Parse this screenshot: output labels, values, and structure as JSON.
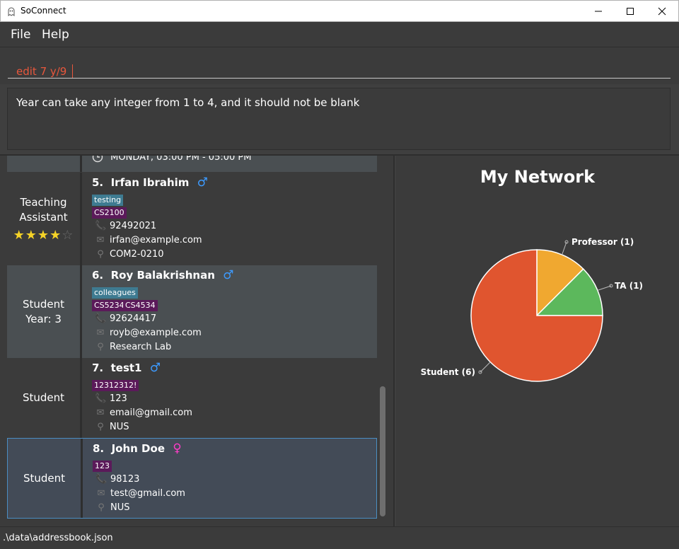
{
  "window": {
    "title": "SoConnect",
    "app_icon": "ghost-icon",
    "controls": [
      "minimize-icon",
      "maximize-icon",
      "close-icon"
    ]
  },
  "menu": {
    "file": "File",
    "help": "Help"
  },
  "command": {
    "value": "edit 7 y/9",
    "placeholder": ""
  },
  "result": {
    "message": "Year can take any integer from 1 to 4, and it should not be blank"
  },
  "list": {
    "partial_card": {
      "text": "MONDAY, 03:00 PM - 05:00 PM",
      "icon": "clock-icon"
    },
    "cards": [
      {
        "role": "Teaching\nAssistant",
        "rating": 4,
        "rating_max": 5,
        "index": "5.",
        "name": "Irfan Ibrahim",
        "gender_icon": "male-icon",
        "tags_blue": [
          "testing"
        ],
        "tags_purple": [
          "CS2100"
        ],
        "phone": "92492021",
        "email": "irfan@example.com",
        "location": "COM2-0210",
        "bg": "#3b3b3b"
      },
      {
        "role": "Student\nYear: 3",
        "index": "6.",
        "name": "Roy Balakrishnan",
        "gender_icon": "male-icon",
        "tags_blue": [
          "colleagues"
        ],
        "tags_purple": [
          "CS5234",
          "CS4534"
        ],
        "phone": "92624417",
        "email": "royb@example.com",
        "location": "Research Lab",
        "bg": "#4a4f52"
      },
      {
        "role": "Student",
        "index": "7.",
        "name": "test1",
        "gender_icon": "male-icon",
        "tags_blue": [],
        "tags_purple": [
          "12312312!"
        ],
        "phone": "123",
        "email": "email@gmail.com",
        "location": "NUS",
        "bg": "#3b3b3b"
      },
      {
        "role": "Student",
        "index": "8.",
        "name": "John Doe",
        "gender_icon": "female-icon",
        "tags_blue": [],
        "tags_purple": [
          "123"
        ],
        "phone": "98123",
        "email": "test@gmail.com",
        "location": "NUS",
        "bg": "#434b57",
        "selected": true
      }
    ]
  },
  "chart_data": {
    "type": "pie",
    "title": "My Network",
    "categories": [
      "Professor",
      "TA",
      "Student"
    ],
    "values": [
      1,
      1,
      6
    ],
    "labels": [
      "Professor (1)",
      "TA (1)",
      "Student (6)"
    ],
    "colors": [
      "#f0a830",
      "#5cb85c",
      "#e0552f"
    ]
  },
  "status": {
    "path": ".\\data\\addressbook.json"
  },
  "colors": {
    "male": "#3d9bff",
    "female": "#ff3cc8",
    "error": "#e8573c",
    "selected_border": "#4b8ec2"
  }
}
